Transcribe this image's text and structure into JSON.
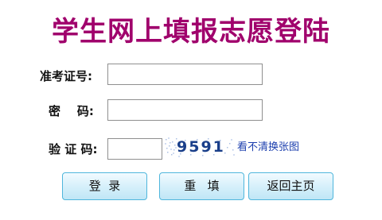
{
  "title": "学生网上填报志愿登陆",
  "form": {
    "ticket_label": "准考证号:",
    "ticket_value": "",
    "password_label": "密    码:",
    "password_value": "",
    "captcha_label": "验 证 码:",
    "captcha_value": ""
  },
  "captcha": {
    "code": "9591",
    "refresh_label": "看不清换张图"
  },
  "buttons": {
    "login": "登  录",
    "reset": "重   填",
    "back": "返回主页"
  }
}
